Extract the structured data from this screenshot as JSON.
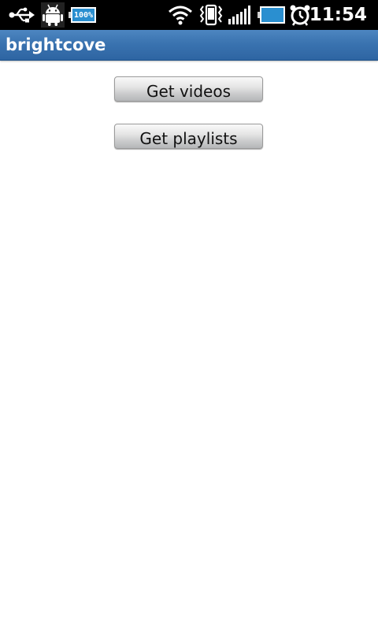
{
  "status_bar": {
    "battery_small_label": "100%",
    "time": "11:54",
    "icons": [
      "usb-icon",
      "android-debug-icon",
      "battery-full-icon",
      "wifi-icon",
      "vibrate-icon",
      "signal-icon",
      "battery-icon",
      "alarm-icon"
    ]
  },
  "app": {
    "title": "brightcove",
    "title_bar_color": "#3a73b0"
  },
  "main": {
    "buttons": [
      {
        "label": "Get videos"
      },
      {
        "label": "Get playlists"
      }
    ]
  }
}
